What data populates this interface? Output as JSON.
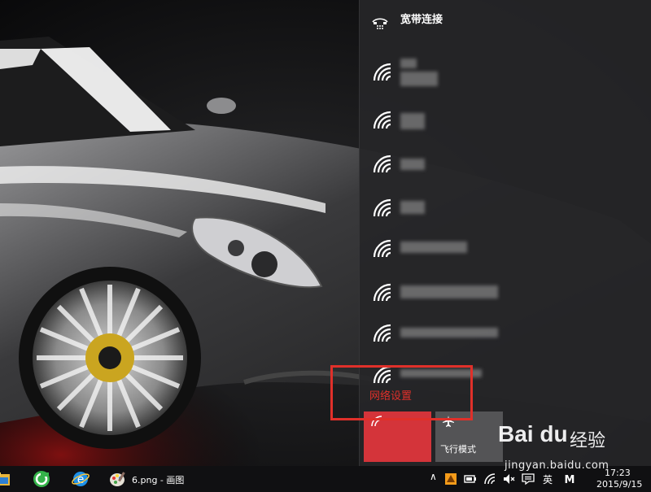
{
  "flyout": {
    "broadband_label": "宽带连接",
    "networks": [
      {
        "label": "",
        "icon": "wifi-icon"
      },
      {
        "label": "",
        "icon": "wifi-icon"
      },
      {
        "label": "",
        "icon": "wifi-icon"
      },
      {
        "label": "",
        "icon": "wifi-icon"
      },
      {
        "label": "",
        "icon": "wifi-icon"
      },
      {
        "label": "",
        "icon": "wifi-icon"
      },
      {
        "label": "",
        "icon": "wifi-icon"
      },
      {
        "label": "",
        "icon": "wifi-icon"
      }
    ],
    "network_settings_label": "网络设置",
    "airplane_mode_label": "飞行模式"
  },
  "taskbar": {
    "window_label": "6.png - 画图",
    "ime_label": "英",
    "clock_time": "17:23",
    "clock_date": "2015/9/15"
  },
  "watermark": {
    "logo": "Bai du",
    "cn": "经验",
    "url": "jingyan.baidu.com"
  },
  "colors": {
    "highlight": "#e0302a",
    "wifi_tile": "#d4343a",
    "flyout_bg": "#262628"
  }
}
